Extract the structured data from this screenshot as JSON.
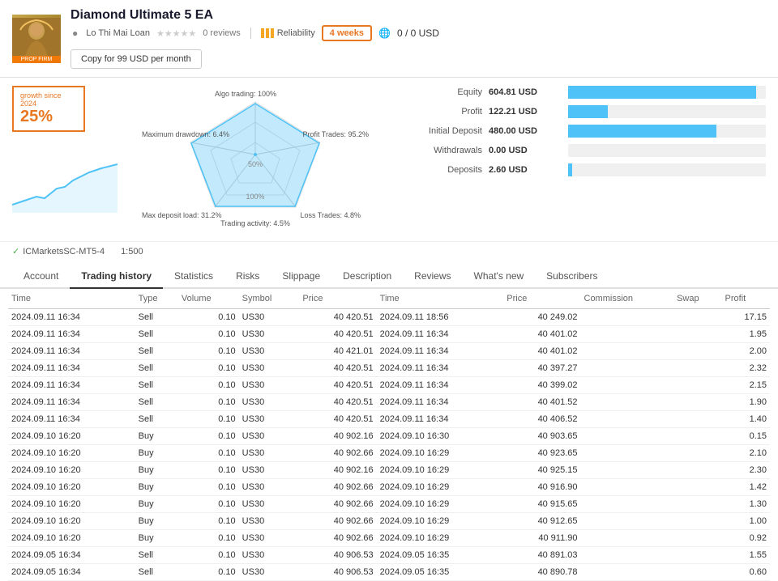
{
  "header": {
    "title": "Diamond Ultimate 5 EA",
    "author": "Lo Thi Mai Loan",
    "stars": "★★★★★",
    "reviews": "0 reviews",
    "reliability_label": "Reliability",
    "weeks": "4 weeks",
    "currency": "0 / 0 USD",
    "copy_button": "Copy for 99 USD per month"
  },
  "growth": {
    "label": "growth since 2024",
    "value": "25%"
  },
  "radar": {
    "algo_trading": "Algo trading: 100%",
    "profit_trades": "Profit Trades: 95.2%",
    "loss_trades": "Loss Trades: 4.8%",
    "trading_activity": "Trading activity: 4.5%",
    "max_deposit_load": "Max deposit load: 31.2%",
    "maximum_drawdown": "Maximum drawdown: 6.4%",
    "center_label": "50%",
    "inner_label": "100%"
  },
  "stats": {
    "equity_label": "Equity",
    "equity_value": "604.81 USD",
    "equity_bar_pct": 95,
    "profit_label": "Profit",
    "profit_value": "122.21 USD",
    "profit_bar_pct": 20,
    "initial_deposit_label": "Initial Deposit",
    "initial_deposit_value": "480.00 USD",
    "initial_deposit_bar_pct": 75,
    "withdrawals_label": "Withdrawals",
    "withdrawals_value": "0.00 USD",
    "withdrawals_bar_pct": 0,
    "deposits_label": "Deposits",
    "deposits_value": "2.60 USD",
    "deposits_bar_pct": 2
  },
  "server": {
    "name": "ICMarketsSC-MT5-4",
    "leverage": "1:500"
  },
  "tabs": [
    "Account",
    "Trading history",
    "Statistics",
    "Risks",
    "Slippage",
    "Description",
    "Reviews",
    "What's new",
    "Subscribers"
  ],
  "active_tab": "Trading history",
  "table_headers": [
    "Time",
    "Type",
    "Volume",
    "Symbol",
    "Price",
    "Time",
    "Price",
    "Commission",
    "Swap",
    "Profit"
  ],
  "rows": [
    [
      "2024.09.11 16:34",
      "Sell",
      "0.10",
      "US30",
      "40 420.51",
      "2024.09.11 18:56",
      "40 249.02",
      "",
      "",
      "17.15"
    ],
    [
      "2024.09.11 16:34",
      "Sell",
      "0.10",
      "US30",
      "40 420.51",
      "2024.09.11 16:34",
      "40 401.02",
      "",
      "",
      "1.95"
    ],
    [
      "2024.09.11 16:34",
      "Sell",
      "0.10",
      "US30",
      "40 421.01",
      "2024.09.11 16:34",
      "40 401.02",
      "",
      "",
      "2.00"
    ],
    [
      "2024.09.11 16:34",
      "Sell",
      "0.10",
      "US30",
      "40 420.51",
      "2024.09.11 16:34",
      "40 397.27",
      "",
      "",
      "2.32"
    ],
    [
      "2024.09.11 16:34",
      "Sell",
      "0.10",
      "US30",
      "40 420.51",
      "2024.09.11 16:34",
      "40 399.02",
      "",
      "",
      "2.15"
    ],
    [
      "2024.09.11 16:34",
      "Sell",
      "0.10",
      "US30",
      "40 420.51",
      "2024.09.11 16:34",
      "40 401.52",
      "",
      "",
      "1.90"
    ],
    [
      "2024.09.11 16:34",
      "Sell",
      "0.10",
      "US30",
      "40 420.51",
      "2024.09.11 16:34",
      "40 406.52",
      "",
      "",
      "1.40"
    ],
    [
      "2024.09.10 16:20",
      "Buy",
      "0.10",
      "US30",
      "40 902.16",
      "2024.09.10 16:30",
      "40 903.65",
      "",
      "",
      "0.15"
    ],
    [
      "2024.09.10 16:20",
      "Buy",
      "0.10",
      "US30",
      "40 902.66",
      "2024.09.10 16:29",
      "40 923.65",
      "",
      "",
      "2.10"
    ],
    [
      "2024.09.10 16:20",
      "Buy",
      "0.10",
      "US30",
      "40 902.16",
      "2024.09.10 16:29",
      "40 925.15",
      "",
      "",
      "2.30"
    ],
    [
      "2024.09.10 16:20",
      "Buy",
      "0.10",
      "US30",
      "40 902.66",
      "2024.09.10 16:29",
      "40 916.90",
      "",
      "",
      "1.42"
    ],
    [
      "2024.09.10 16:20",
      "Buy",
      "0.10",
      "US30",
      "40 902.66",
      "2024.09.10 16:29",
      "40 915.65",
      "",
      "",
      "1.30"
    ],
    [
      "2024.09.10 16:20",
      "Buy",
      "0.10",
      "US30",
      "40 902.66",
      "2024.09.10 16:29",
      "40 912.65",
      "",
      "",
      "1.00"
    ],
    [
      "2024.09.10 16:20",
      "Buy",
      "0.10",
      "US30",
      "40 902.66",
      "2024.09.10 16:29",
      "40 911.90",
      "",
      "",
      "0.92"
    ],
    [
      "2024.09.05 16:34",
      "Sell",
      "0.10",
      "US30",
      "40 906.53",
      "2024.09.05 16:35",
      "40 891.03",
      "",
      "",
      "1.55"
    ],
    [
      "2024.09.05 16:34",
      "Sell",
      "0.10",
      "US30",
      "40 906.53",
      "2024.09.05 16:35",
      "40 890.78",
      "",
      "",
      "0.60"
    ]
  ]
}
